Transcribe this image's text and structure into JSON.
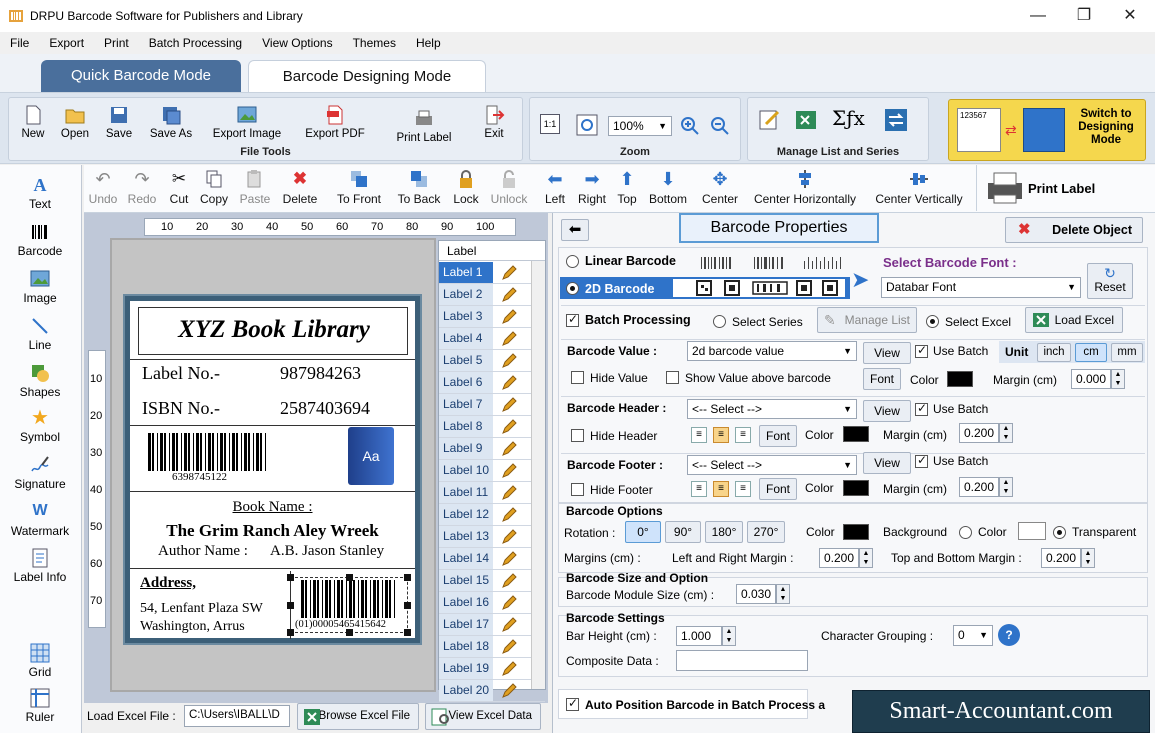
{
  "window": {
    "title": "DRPU Barcode Software for Publishers and Library",
    "min": "—",
    "max": "❐",
    "close": "✕"
  },
  "menu": [
    "File",
    "Export",
    "Print",
    "Batch Processing",
    "View Options",
    "Themes",
    "Help"
  ],
  "modes": {
    "quick": "Quick Barcode Mode",
    "designing": "Barcode Designing Mode"
  },
  "ribbon": {
    "file_tools": {
      "label": "File Tools",
      "items": [
        "New",
        "Open",
        "Save",
        "Save As",
        "Export Image",
        "Export PDF",
        "Print Label",
        "Exit"
      ]
    },
    "zoom": {
      "label": "Zoom",
      "value": "100%",
      "fit": "1:1"
    },
    "manage": {
      "label": "Manage List and Series",
      "sigma": "Σƒx"
    },
    "switch": {
      "label": "Switch to Designing Mode",
      "thumb": "123567"
    }
  },
  "toolbar": [
    "Undo",
    "Redo",
    "Cut",
    "Copy",
    "Paste",
    "Delete",
    "To Front",
    "To Back",
    "Lock",
    "Unlock",
    "Left",
    "Right",
    "Top",
    "Bottom",
    "Center",
    "Center Horizontally",
    "Center Vertically"
  ],
  "print_label": "Print Label",
  "left_tools": [
    "Text",
    "Barcode",
    "Image",
    "Line",
    "Shapes",
    "Symbol",
    "Signature",
    "Watermark",
    "Label Info",
    "Grid",
    "Ruler"
  ],
  "ruler": {
    "h": [
      "10",
      "20",
      "30",
      "40",
      "50",
      "60",
      "70",
      "80",
      "90",
      "100"
    ],
    "v": [
      "10",
      "20",
      "30",
      "40",
      "50",
      "60",
      "70"
    ]
  },
  "card": {
    "title": "XYZ Book Library",
    "label_no_key": "Label No.-",
    "label_no_val": "987984263",
    "isbn_key": "ISBN No.-",
    "isbn_val": "2587403694",
    "barcode_num": "6398745122",
    "book_name_key": "Book Name :",
    "book_name": "The Grim Ranch Aley Wreek",
    "author_key": "Author Name :",
    "author": "A.B. Jason Stanley",
    "address_key": "Address,",
    "address1": "54, Lenfant Plaza SW",
    "address2": "Washington, Arrus",
    "barcode2_num": "(01)00005465415642",
    "book_icon": "Aa"
  },
  "labels": {
    "header": "Label",
    "items": [
      "Label 1",
      "Label 2",
      "Label 3",
      "Label 4",
      "Label 5",
      "Label 6",
      "Label 7",
      "Label 8",
      "Label 9",
      "Label 10",
      "Label 11",
      "Label 12",
      "Label 13",
      "Label 14",
      "Label 15",
      "Label 16",
      "Label 17",
      "Label 18",
      "Label 19",
      "Label 20"
    ]
  },
  "bottom": {
    "load_label": "Load Excel File :",
    "path": "C:\\Users\\IBALL\\D",
    "browse": "Browse Excel File",
    "view": "View Excel Data"
  },
  "props": {
    "title": "Barcode Properties",
    "delete": "Delete Object",
    "linear": "Linear Barcode",
    "twod": "2D Barcode",
    "select_font_label": "Select Barcode Font :",
    "font": "Databar Font",
    "reset": "Reset",
    "batch": "Batch Processing",
    "select_series": "Select Series",
    "manage_list": "Manage List",
    "select_excel": "Select Excel",
    "load_excel": "Load Excel",
    "value_label": "Barcode Value :",
    "value": "2d barcode value",
    "view": "View",
    "use_batch": "Use Batch",
    "unit": "Unit",
    "inch": "inch",
    "cm": "cm",
    "mm": "mm",
    "hide_value": "Hide Value",
    "show_above": "Show Value above barcode",
    "font_btn": "Font",
    "color": "Color",
    "margin": "Margin (cm)",
    "margin_val": "0.000",
    "header_label": "Barcode Header :",
    "select": "<-- Select -->",
    "hide_header": "Hide Header",
    "header_margin": "0.200",
    "footer_label": "Barcode Footer :",
    "hide_footer": "Hide Footer",
    "footer_margin": "0.200",
    "options_title": "Barcode Options",
    "rotation": "Rotation :",
    "rot": [
      "0°",
      "90°",
      "180°",
      "270°"
    ],
    "background": "Background",
    "color_opt": "Color",
    "transparent": "Transparent",
    "margins": "Margins (cm) :",
    "lr": "Left and Right Margin :",
    "lr_val": "0.200",
    "tb": "Top and Bottom Margin :",
    "tb_val": "0.200",
    "size_title": "Barcode Size and Option",
    "module": "Barcode Module Size (cm) :",
    "module_val": "0.030",
    "settings_title": "Barcode Settings",
    "bar_height": "Bar Height (cm) :",
    "bar_height_val": "1.000",
    "grouping": "Character Grouping :",
    "grouping_val": "0",
    "composite": "Composite Data :",
    "auto": "Auto Position Barcode in Batch Process a",
    "help": "?"
  },
  "watermark": "Smart-Accountant.com",
  "colors": {
    "accent": "#2f73c9",
    "tab_active": "#4a6f9c",
    "switch_bg": "#f3d34a",
    "card_border": "#3c5f78"
  }
}
